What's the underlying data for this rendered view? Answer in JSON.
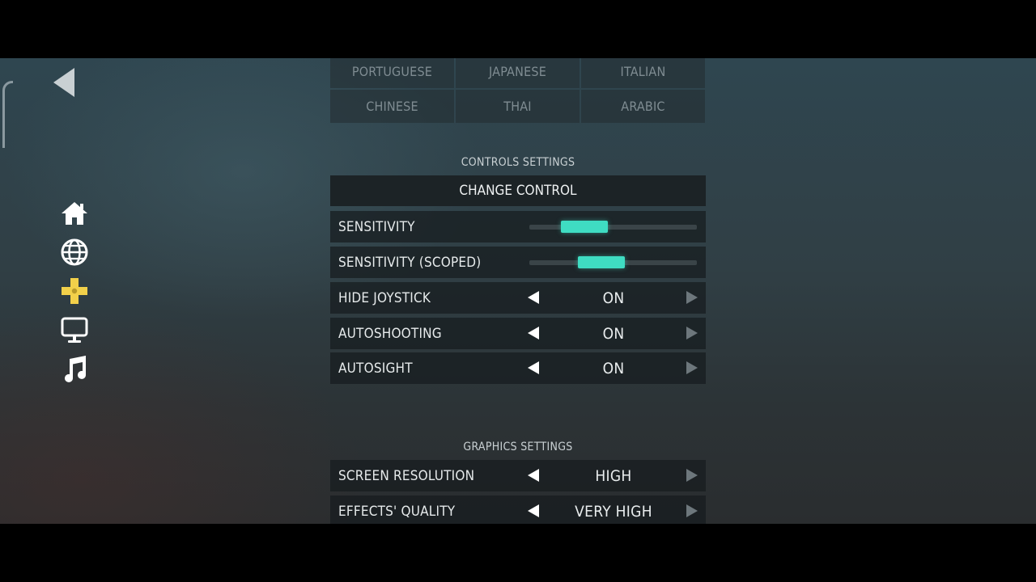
{
  "languages": [
    [
      "PORTUGUESE",
      "JAPANESE",
      "ITALIAN"
    ],
    [
      "CHINESE",
      "THAI",
      "ARABIC"
    ]
  ],
  "nav": {
    "items": [
      {
        "icon": "home-icon",
        "active": false
      },
      {
        "icon": "globe-icon",
        "active": false
      },
      {
        "icon": "gamepad-icon",
        "active": true
      },
      {
        "icon": "monitor-icon",
        "active": false
      },
      {
        "icon": "music-icon",
        "active": false
      }
    ]
  },
  "controls": {
    "section_title": "CONTROLS SETTINGS",
    "change_control": "CHANGE CONTROL",
    "sensitivity": {
      "label": "SENSITIVITY",
      "value": 0.33
    },
    "sensitivity_scoped": {
      "label": "SENSITIVITY (SCOPED)",
      "value": 0.43
    },
    "hide_joystick": {
      "label": "HIDE JOYSTICK",
      "value": "ON"
    },
    "autoshooting": {
      "label": "AUTOSHOOTING",
      "value": "ON"
    },
    "autosight": {
      "label": "AUTOSIGHT",
      "value": "ON"
    }
  },
  "graphics": {
    "section_title": "GRAPHICS SETTINGS",
    "screen_resolution": {
      "label": "SCREEN RESOLUTION",
      "value": "HIGH"
    },
    "effects_quality": {
      "label": "EFFECTS' QUALITY",
      "value": "VERY HIGH"
    }
  },
  "colors": {
    "accent": "#3fdcc2",
    "active_nav": "#f2d04a"
  }
}
